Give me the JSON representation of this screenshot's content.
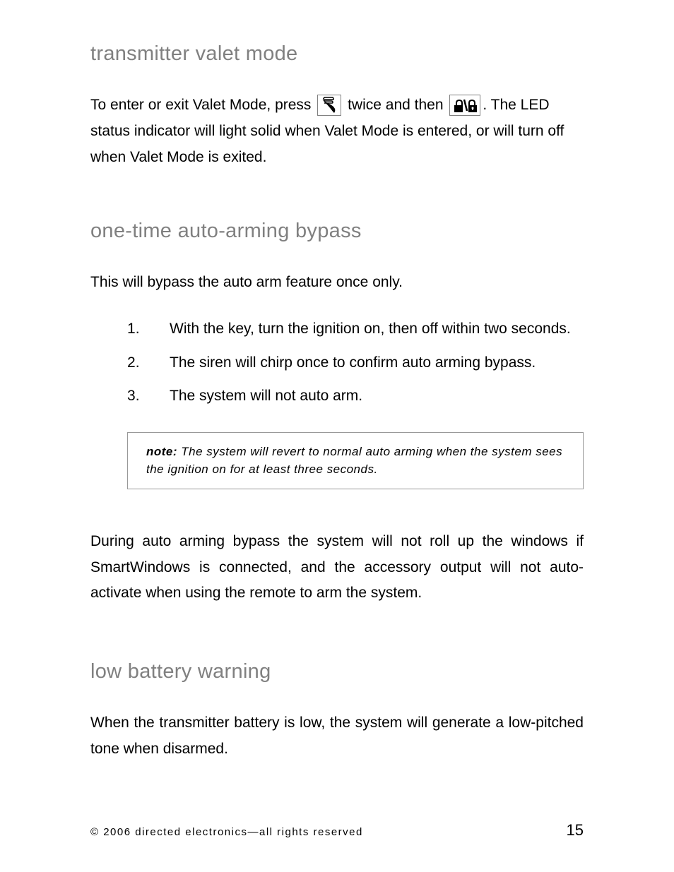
{
  "sections": {
    "valet": {
      "heading": "transmitter valet mode",
      "p1_a": "To enter or exit Valet Mode, press ",
      "p1_b": " twice and then ",
      "p1_c": ". The LED status indicator will light solid when Valet Mode is entered, or will turn off when Valet Mode is exited."
    },
    "bypass": {
      "heading": "one-time auto-arming bypass",
      "intro": "This will bypass the auto arm feature once only.",
      "steps": [
        "With the key, turn the ignition on, then off within two seconds.",
        "The siren will chirp once to confirm auto arming bypass.",
        "The system will not auto arm."
      ],
      "note_label": "note:",
      "note_text": " The system will revert to normal auto arming when the system sees the ignition on for at least three seconds.",
      "during": "During auto arming bypass the system will not roll up the windows if SmartWindows is connected, and the accessory output will not auto-activate when using the remote to arm the system."
    },
    "low_battery": {
      "heading": "low battery warning",
      "body": "When the transmitter battery is low, the system will generate a low-pitched tone when disarmed."
    }
  },
  "footer": {
    "copyright": "© 2006 directed electronics—all rights reserved",
    "page_number": "15"
  },
  "icons": {
    "clifford_button": "clifford-g-button-icon",
    "lock_button": "lock-unlock-button-icon"
  }
}
